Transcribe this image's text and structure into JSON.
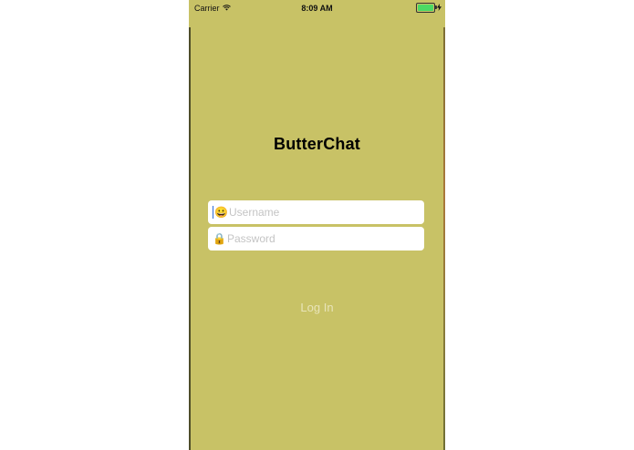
{
  "status_bar": {
    "carrier": "Carrier",
    "time": "8:09 AM",
    "battery_level": 1.0,
    "battery_color": "#4cd964"
  },
  "app": {
    "title": "ButterChat",
    "background_color": "#c8c266"
  },
  "form": {
    "username": {
      "icon": "smiley-face-icon",
      "glyph": "😀",
      "placeholder": "Username",
      "value": ""
    },
    "password": {
      "icon": "lock-icon",
      "glyph": "🔒",
      "placeholder": "Password",
      "value": ""
    },
    "login_label": "Log In"
  }
}
